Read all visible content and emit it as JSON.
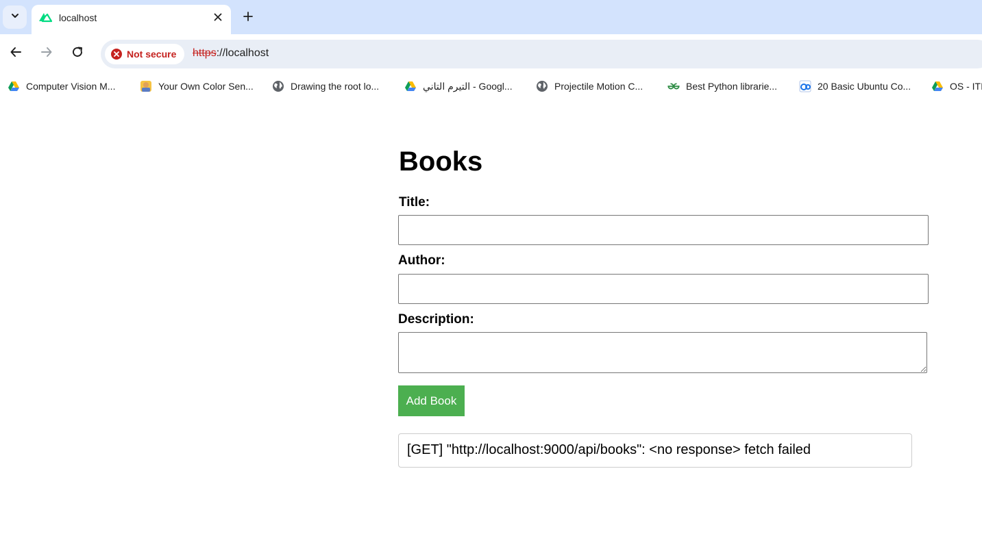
{
  "browser": {
    "tab": {
      "title": "localhost",
      "favicon": "nuxt-logo-icon"
    },
    "omnibox": {
      "security_label": "Not secure",
      "url_scheme": "https",
      "url_rest": "://localhost"
    },
    "bookmarks": [
      {
        "label": "Computer Vision M...",
        "icon": "google-drive-icon"
      },
      {
        "label": "Your Own Color Sen...",
        "icon": "avatar-icon"
      },
      {
        "label": "Drawing the root lo...",
        "icon": "globe-icon"
      },
      {
        "label": "التيرم التاني - Googl...",
        "icon": "google-drive-icon"
      },
      {
        "label": "Projectile Motion C...",
        "icon": "globe-icon"
      },
      {
        "label": "Best Python librarie...",
        "icon": "geeksforgeeks-icon"
      },
      {
        "label": "20 Basic Ubuntu Co...",
        "icon": "site-icon"
      },
      {
        "label": "OS - ITI",
        "icon": "google-drive-icon"
      }
    ]
  },
  "page": {
    "title": "Books",
    "form": {
      "title_label": "Title:",
      "author_label": "Author:",
      "description_label": "Description:",
      "title_value": "",
      "author_value": "",
      "description_value": "",
      "submit_label": "Add Book"
    },
    "error_message": "[GET] \"http://localhost:9000/api/books\": <no response> fetch failed"
  },
  "colors": {
    "tabstrip_bg": "#d3e3fd",
    "omnibox_bg": "#e9eef6",
    "danger": "#c5221f",
    "button_green": "#4caf50"
  }
}
